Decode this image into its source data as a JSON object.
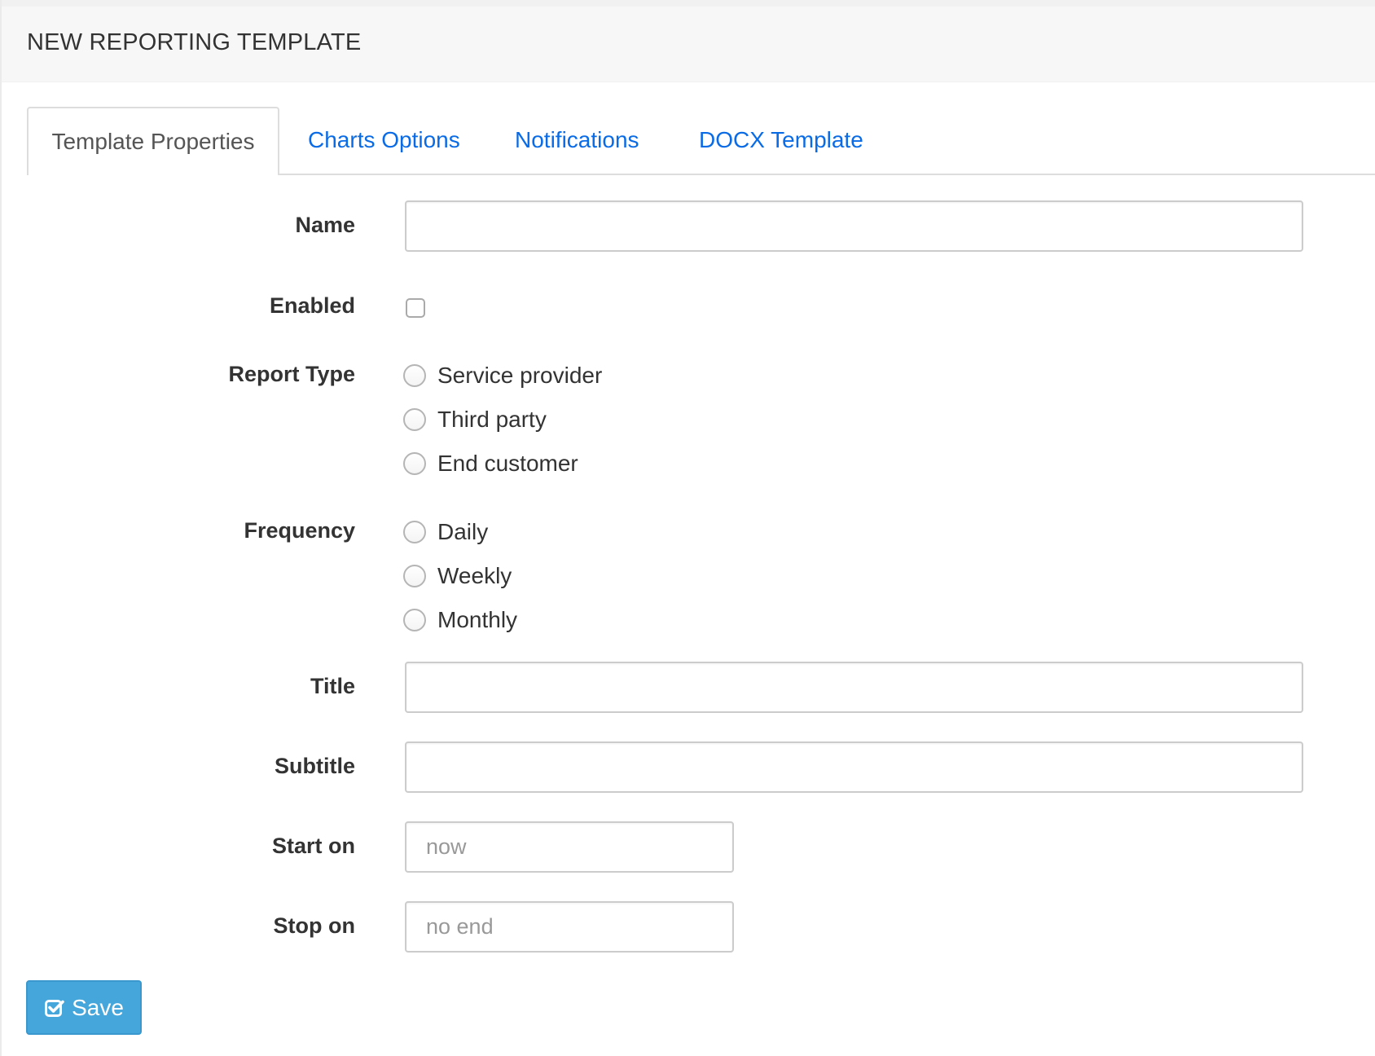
{
  "header": {
    "title": "NEW REPORTING TEMPLATE"
  },
  "tabs": [
    {
      "label": "Template Properties",
      "active": true
    },
    {
      "label": "Charts Options",
      "active": false
    },
    {
      "label": "Notifications",
      "active": false
    },
    {
      "label": "DOCX Template",
      "active": false
    }
  ],
  "form": {
    "name": {
      "label": "Name",
      "value": "",
      "placeholder": ""
    },
    "enabled": {
      "label": "Enabled",
      "checked": false
    },
    "report_type": {
      "label": "Report Type",
      "options": [
        "Service provider",
        "Third party",
        "End customer"
      ],
      "selected": null
    },
    "frequency": {
      "label": "Frequency",
      "options": [
        "Daily",
        "Weekly",
        "Monthly"
      ],
      "selected": null
    },
    "title": {
      "label": "Title",
      "value": "",
      "placeholder": ""
    },
    "subtitle": {
      "label": "Subtitle",
      "value": "",
      "placeholder": ""
    },
    "start_on": {
      "label": "Start on",
      "value": "",
      "placeholder": "now"
    },
    "stop_on": {
      "label": "Stop on",
      "value": "",
      "placeholder": "no end"
    }
  },
  "actions": {
    "save_label": "Save",
    "save_icon": "check-square-icon",
    "save_color": "#44a6db"
  },
  "colors": {
    "tab_link": "#0a6be6",
    "header_bg": "#f7f7f7"
  }
}
